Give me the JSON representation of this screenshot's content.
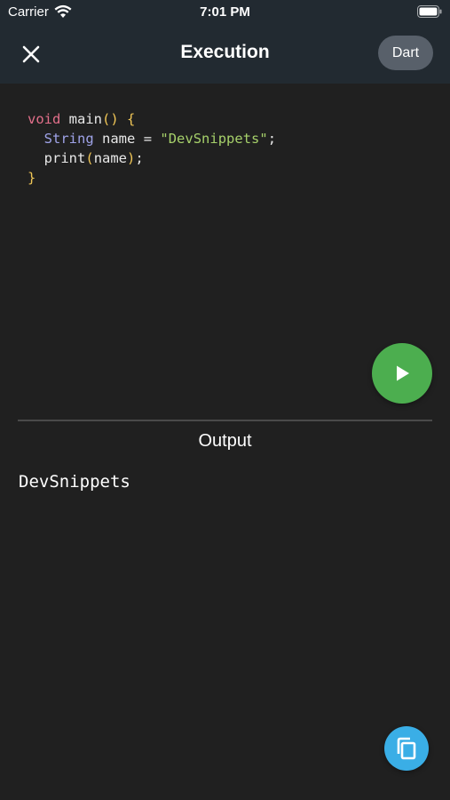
{
  "status_bar": {
    "carrier": "Carrier",
    "time": "7:01 PM",
    "wifi_icon": "wifi-icon",
    "battery_icon": "battery-icon"
  },
  "header": {
    "title": "Execution",
    "close_icon": "close-icon",
    "language": "Dart",
    "background_color": "#222a31"
  },
  "editor": {
    "tokens": {
      "void": "void",
      "main": "main",
      "parens": "()",
      "open_brace": "{",
      "string_type": "String",
      "name_var": "name",
      "equals": "=",
      "string_literal": "\"DevSnippets\"",
      "semicolon": ";",
      "print": "print",
      "print_open": "(",
      "print_arg": "name",
      "print_close": ")",
      "print_semicolon": ";",
      "close_brace": "}"
    },
    "colors": {
      "keyword": "#e26f8a",
      "type": "#9fa3e8",
      "string": "#a6d06a",
      "bracket": "#f0c656"
    }
  },
  "run_button": {
    "icon": "play-icon",
    "color": "#4cae4f"
  },
  "output": {
    "title": "Output",
    "text": "DevSnippets"
  },
  "copy_button": {
    "icon": "copy-icon",
    "color": "#3aaee6"
  }
}
